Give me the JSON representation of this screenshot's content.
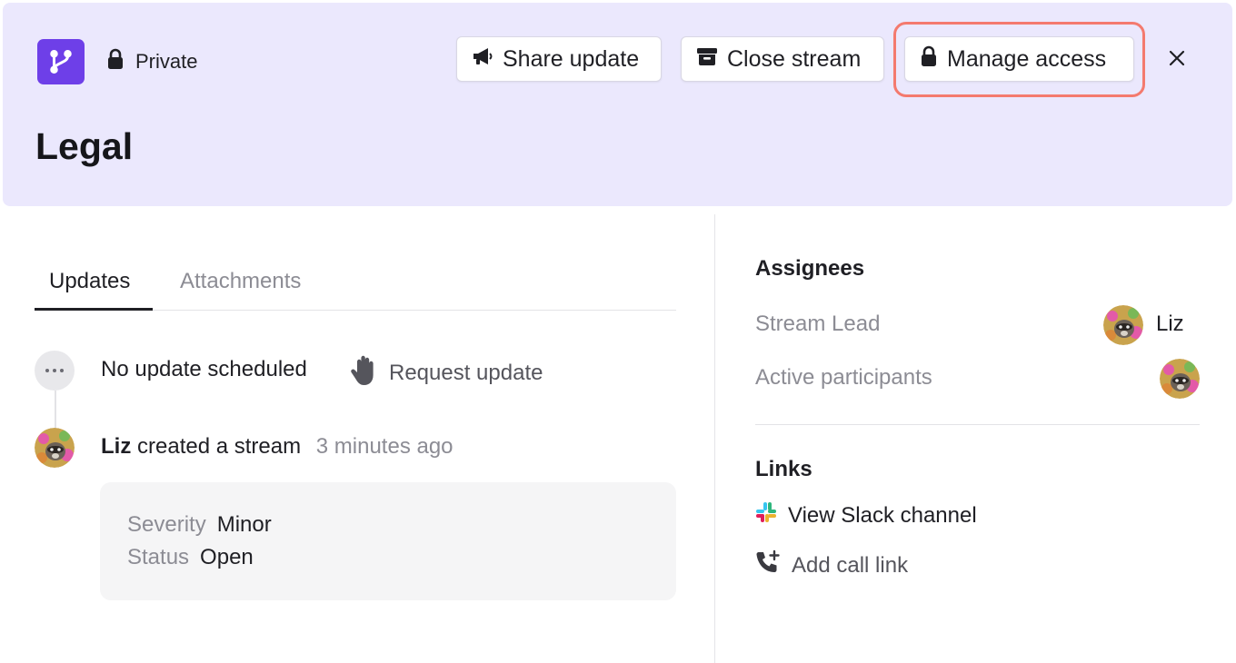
{
  "header": {
    "privacy_label": "Private",
    "title": "Legal",
    "buttons": {
      "share": "Share update",
      "close": "Close stream",
      "manage": "Manage access"
    },
    "colors": {
      "background": "#ebe8fd",
      "app_icon": "#6e3fe8",
      "highlight": "#f47a6e"
    }
  },
  "tabs": [
    {
      "label": "Updates",
      "active": true
    },
    {
      "label": "Attachments",
      "active": false
    }
  ],
  "feed": {
    "no_update": "No update scheduled",
    "request_update": "Request update",
    "event": {
      "user": "Liz",
      "action": "created a stream",
      "time": "3 minutes ago"
    },
    "details": [
      {
        "key": "Severity",
        "value": "Minor"
      },
      {
        "key": "Status",
        "value": "Open"
      }
    ]
  },
  "sidebar": {
    "assignees_heading": "Assignees",
    "stream_lead_label": "Stream Lead",
    "stream_lead_name": "Liz",
    "active_participants_label": "Active participants",
    "links_heading": "Links",
    "links": [
      {
        "label": "View Slack channel",
        "icon": "slack-icon"
      },
      {
        "label": "Add call link",
        "icon": "phone-plus-icon"
      }
    ]
  }
}
